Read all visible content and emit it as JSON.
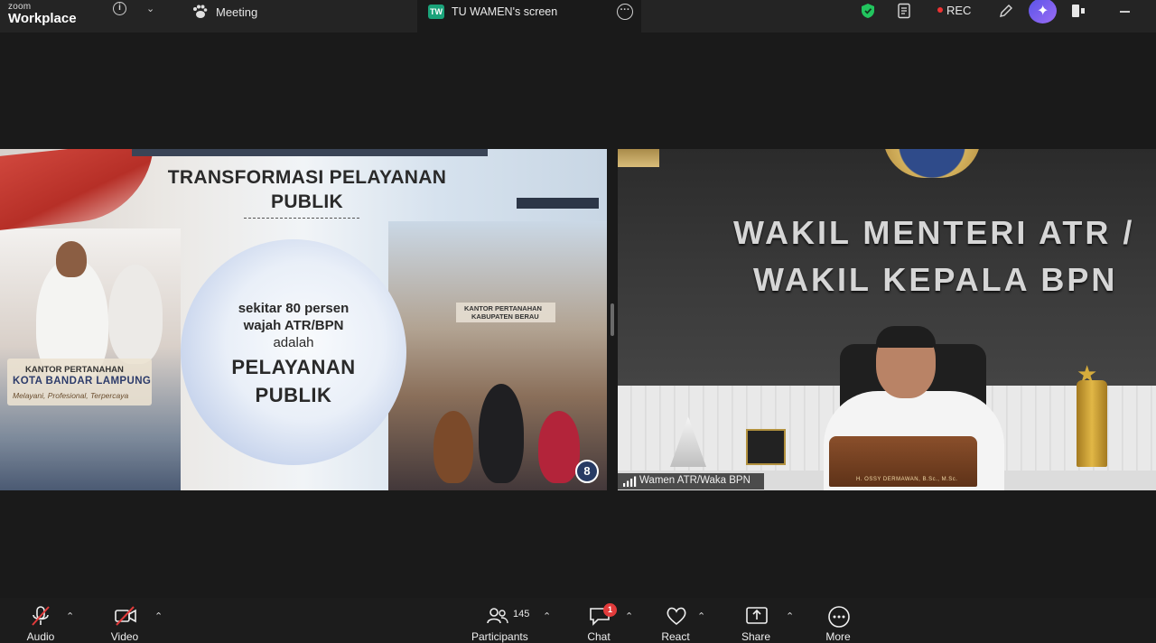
{
  "app": {
    "logo_small": "zoom",
    "logo_large": "Workplace"
  },
  "topbar": {
    "meeting_label": "Meeting",
    "screen_tab_badge": "TW",
    "screen_tab_label": "TU WAMEN's screen",
    "rec_label": "REC",
    "icons": [
      "info-icon",
      "chevron-down-icon",
      "paw-icon",
      "more-icon",
      "shield-icon",
      "notes-icon",
      "pen-icon",
      "ai-companion-icon",
      "side-panel-icon",
      "minimize-icon"
    ]
  },
  "slide": {
    "title_line1": "TRANSFORMASI PELAYANAN",
    "title_line2": "PUBLIK",
    "bubble_line1": "sekitar 80 persen",
    "bubble_line2": "wajah ATR/BPN",
    "bubble_line3": "adalah",
    "bubble_line4": "PELAYANAN",
    "bubble_line5": "PUBLIK",
    "sign_left_line1": "KANTOR PERTANAHAN",
    "sign_left_line2": "KOTA BANDAR LAMPUNG",
    "sign_left_line3": "Melayani, Profesional, Terpercaya",
    "sign_right_line1": "KANTOR PERTANAHAN",
    "sign_right_line2": "KABUPATEN BERAU",
    "page_number": "8"
  },
  "video": {
    "wall_line1": "WAKIL MENTERI ATR /",
    "wall_line2": "WAKIL KEPALA BPN",
    "nameplate": "H. OSSY DERMAWAN, B.Sc., M.Sc.",
    "participant_label": "Wamen ATR/Waka BPN"
  },
  "toolbar": {
    "audio_label": "Audio",
    "video_label": "Video",
    "participants_label": "Participants",
    "participants_count": "145",
    "chat_label": "Chat",
    "chat_badge": "1",
    "react_label": "React",
    "share_label": "Share",
    "more_label": "More"
  },
  "colors": {
    "rec": "#e33333",
    "shield": "#22c55e",
    "tw_badge": "#1aa37a",
    "chat_badge": "#e23b3b",
    "muted_slash": "#e23b3b"
  }
}
